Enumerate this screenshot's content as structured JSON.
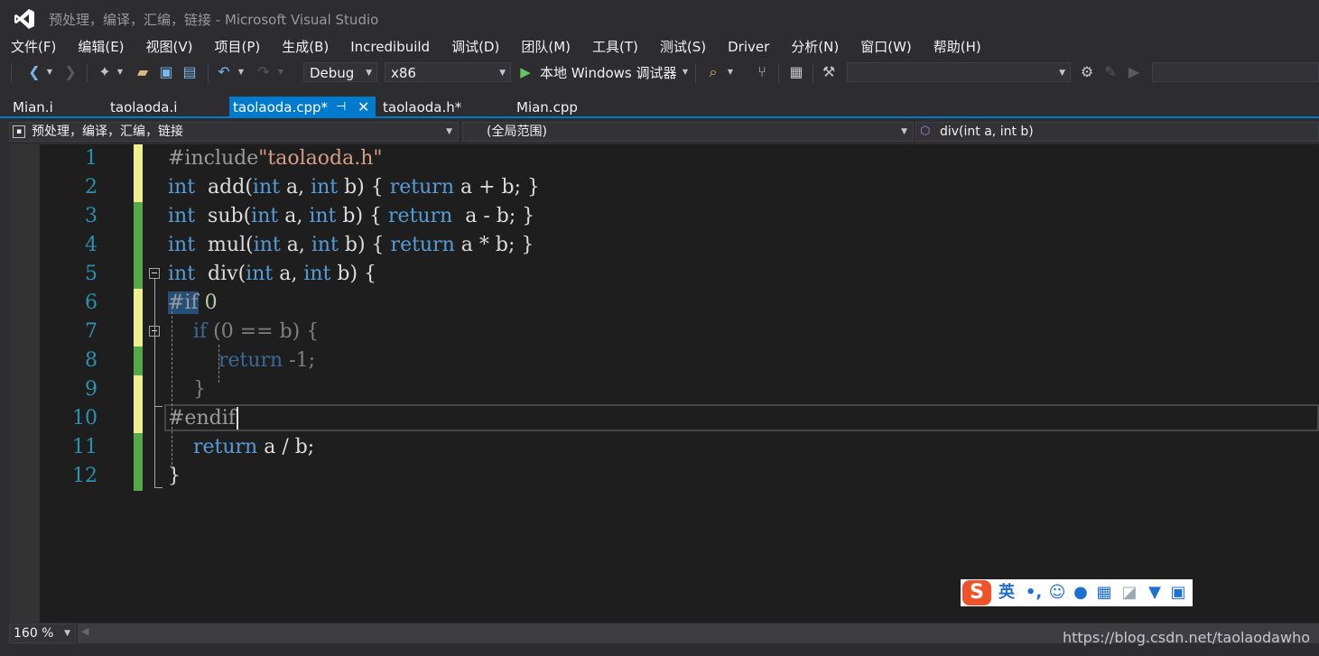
{
  "window": {
    "title": "预处理，编译，汇编，链接 - Microsoft Visual Studio"
  },
  "menu": [
    "文件(F)",
    "编辑(E)",
    "视图(V)",
    "项目(P)",
    "生成(B)",
    "Incredibuild",
    "调试(D)",
    "团队(M)",
    "工具(T)",
    "测试(S)",
    "Driver",
    "分析(N)",
    "窗口(W)",
    "帮助(H)"
  ],
  "toolbar": {
    "config": "Debug",
    "platform": "x86",
    "run_label": "本地 Windows 调试器"
  },
  "tabs": [
    {
      "label": "Mian.i"
    },
    {
      "label": "taolaoda.i"
    },
    {
      "label": "taolaoda.cpp*",
      "active": true
    },
    {
      "label": "taolaoda.h*"
    },
    {
      "label": "Mian.cpp"
    }
  ],
  "nav": {
    "project": "预处理，编译，汇编，链接",
    "scope": "(全局范围)",
    "member": "div(int a, int b)"
  },
  "editor": {
    "line_numbers": [
      "1",
      "2",
      "3",
      "4",
      "5",
      "6",
      "7",
      "8",
      "9",
      "10",
      "11",
      "12"
    ],
    "code": [
      {
        "parts": [
          [
            "pp",
            "#include"
          ],
          [
            "str",
            "\"taolaoda.h\""
          ]
        ]
      },
      {
        "parts": [
          [
            "kw",
            "int"
          ],
          [
            "txt",
            "  add("
          ],
          [
            "kw",
            "int"
          ],
          [
            "txt",
            " a, "
          ],
          [
            "kw",
            "int"
          ],
          [
            "txt",
            " b) { "
          ],
          [
            "kw",
            "return"
          ],
          [
            "txt",
            " a + b; }"
          ]
        ]
      },
      {
        "parts": [
          [
            "kw",
            "int"
          ],
          [
            "txt",
            "  sub("
          ],
          [
            "kw",
            "int"
          ],
          [
            "txt",
            " a, "
          ],
          [
            "kw",
            "int"
          ],
          [
            "txt",
            " b) { "
          ],
          [
            "kw",
            "return"
          ],
          [
            "txt",
            "  a - b; }"
          ]
        ]
      },
      {
        "parts": [
          [
            "kw",
            "int"
          ],
          [
            "txt",
            "  mul("
          ],
          [
            "kw",
            "int"
          ],
          [
            "txt",
            " a, "
          ],
          [
            "kw",
            "int"
          ],
          [
            "txt",
            " b) { "
          ],
          [
            "kw",
            "return"
          ],
          [
            "txt",
            " a * b; }"
          ]
        ]
      },
      {
        "parts": [
          [
            "kw",
            "int"
          ],
          [
            "txt",
            "  div("
          ],
          [
            "kw",
            "int"
          ],
          [
            "txt",
            " a, "
          ],
          [
            "kw",
            "int"
          ],
          [
            "txt",
            " b) {"
          ]
        ]
      },
      {
        "parts": [
          [
            "ppsel",
            "#if"
          ],
          [
            "num",
            " 0"
          ]
        ]
      },
      {
        "parts": [
          [
            "txt",
            "    "
          ],
          [
            "dimkw",
            "if"
          ],
          [
            "grey",
            " (0 == b) {"
          ]
        ]
      },
      {
        "parts": [
          [
            "txt",
            "        "
          ],
          [
            "dimkw",
            "return"
          ],
          [
            "grey",
            " -1;"
          ]
        ]
      },
      {
        "parts": [
          [
            "grey",
            "    }"
          ]
        ]
      },
      {
        "parts": [
          [
            "pp",
            "#endif"
          ]
        ]
      },
      {
        "parts": [
          [
            "txt",
            "    "
          ],
          [
            "kw",
            "return"
          ],
          [
            "txt",
            " a / b;"
          ]
        ]
      },
      {
        "parts": [
          [
            "txt",
            "}"
          ]
        ]
      }
    ]
  },
  "status": {
    "zoom": "160 %"
  },
  "watermark": "https://blog.csdn.net/taolaodawho",
  "ime": {
    "lang": "英"
  },
  "colors": {
    "accent": "#007acc",
    "keyword": "#569cd6",
    "line_number": "#2b91af",
    "saved_change": "#57a64a",
    "unsaved_change": "#efef91"
  }
}
